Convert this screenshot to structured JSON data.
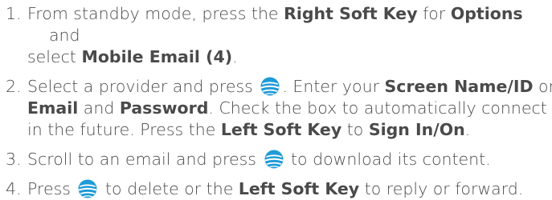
{
  "steps": [
    {
      "number": "1.",
      "line1_a": "From standby mode, press the ",
      "line1_b": "Right Soft Key",
      "line1_c": " for ",
      "line1_d": "Options",
      "line2": "and",
      "line3_a": "select ",
      "line3_b": "Mobile Email (4)",
      "line3_c": "."
    },
    {
      "number": "2.",
      "line1_a": "Select a provider and press ",
      "line1_b": ". Enter your ",
      "line1_c": "Screen Name/ID",
      "line1_d": " or",
      "line2_a": "Email",
      "line2_b": " and ",
      "line2_c": "Password",
      "line2_d": ". Check the box to automatically connect",
      "line3_a": "in the future. Press the ",
      "line3_b": "Left Soft Key",
      "line3_c": " to ",
      "line3_d": "Sign In/On",
      "line3_e": "."
    },
    {
      "number": "3.",
      "text_a": "Scroll to an email and press ",
      "text_b": " to download its content."
    },
    {
      "number": "4.",
      "text_a": "Press ",
      "text_b": " to delete or the ",
      "text_c": "Left Soft Key",
      "text_d": " to reply or forward."
    }
  ],
  "icons": {
    "center_key": "att-globe-icon"
  },
  "colors": {
    "text": "#4a4a4a",
    "globe_blue": "#1f9bd7"
  }
}
